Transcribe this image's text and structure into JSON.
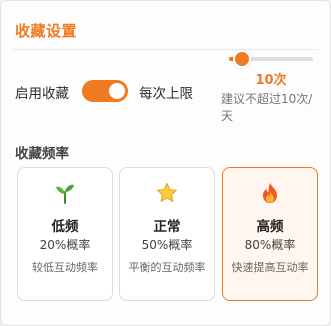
{
  "header": {
    "title": "收藏设置"
  },
  "enable": {
    "label": "启用收藏",
    "on": true
  },
  "limit": {
    "label": "每次上限",
    "value_text": "10次",
    "hint": "建议不超过10次/天",
    "slider_value": 10,
    "slider_fraction": 0.15
  },
  "frequency": {
    "section_title": "收藏频率",
    "options": [
      {
        "name": "低频",
        "rate": "20%概率",
        "desc": "较低互动频率",
        "icon": "sprout-icon",
        "selected": false
      },
      {
        "name": "正常",
        "rate": "50%概率",
        "desc": "平衡的互动频率",
        "icon": "star-icon",
        "selected": false
      },
      {
        "name": "高频",
        "rate": "80%概率",
        "desc": "快速提高互动率",
        "icon": "fire-icon",
        "selected": true
      }
    ]
  },
  "colors": {
    "accent": "#f07a22",
    "selected_bg": "#fff6ef",
    "track": "#dedede"
  }
}
